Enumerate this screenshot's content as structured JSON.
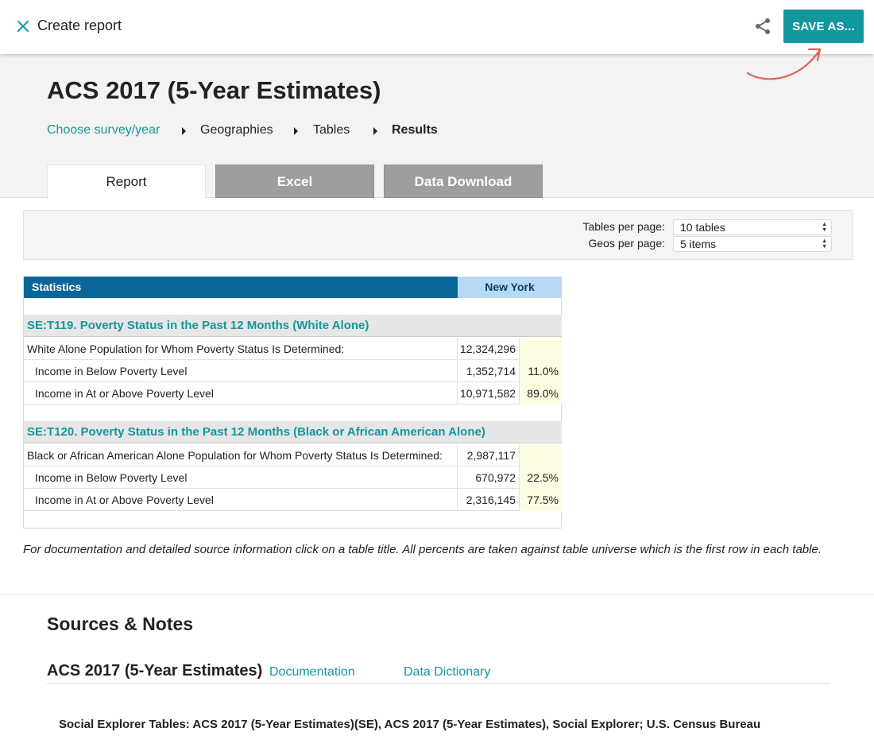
{
  "topbar": {
    "title": "Create report",
    "save_label": "SAVE AS..."
  },
  "header": {
    "page_title": "ACS 2017 (5-Year Estimates)",
    "breadcrumb": [
      "Choose survey/year",
      "Geographies",
      "Tables",
      "Results"
    ],
    "tabs": [
      "Report",
      "Excel",
      "Data Download"
    ]
  },
  "options": {
    "tables_label": "Tables per page:",
    "tables_value": "10 tables",
    "geos_label": "Geos per page:",
    "geos_value": "5 items"
  },
  "table": {
    "header_stats": "Statistics",
    "header_geo": "New York",
    "sections": [
      {
        "title": "SE:T119. Poverty Status in the Past 12 Months (White Alone)",
        "rows": [
          {
            "label": "White Alone Population for Whom Poverty Status Is Determined:",
            "value": "12,324,296",
            "pct": ""
          },
          {
            "label": "Income in Below Poverty Level",
            "value": "1,352,714",
            "pct": "11.0%"
          },
          {
            "label": "Income in At or Above Poverty Level",
            "value": "10,971,582",
            "pct": "89.0%"
          }
        ]
      },
      {
        "title": "SE:T120. Poverty Status in the Past 12 Months (Black or African American Alone)",
        "rows": [
          {
            "label": "Black or African American Alone Population for Whom Poverty Status Is Determined:",
            "value": "2,987,117",
            "pct": ""
          },
          {
            "label": "Income in Below Poverty Level",
            "value": "670,972",
            "pct": "22.5%"
          },
          {
            "label": "Income in At or Above Poverty Level",
            "value": "2,316,145",
            "pct": "77.5%"
          }
        ]
      }
    ]
  },
  "note": "For documentation and detailed source information click on a table title.  All percents are taken against table universe which is the first row in each table.",
  "sources": {
    "title": "Sources & Notes",
    "survey": "ACS 2017 (5-Year Estimates)",
    "documentation_label": "Documentation",
    "dictionary_label": "Data Dictionary",
    "text": "Social Explorer Tables: ACS 2017 (5-Year Estimates)(SE), ACS 2017 (5-Year Estimates), Social Explorer; U.S. Census Bureau"
  },
  "colors": {
    "accent": "#13979e",
    "table_header": "#0c6598",
    "geo_header": "#b7d9f6",
    "annotation_arrow": "#e0625a"
  },
  "icons": [
    "close-icon",
    "share-icon",
    "chevron-right-icon",
    "select-arrows-icon",
    "annotation-arrow"
  ]
}
